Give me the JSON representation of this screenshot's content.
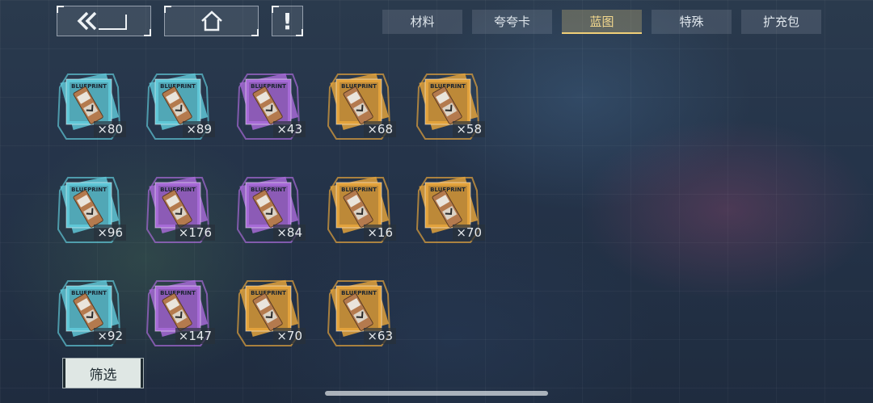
{
  "nav": {
    "back_icon": "double-chevron-back-icon",
    "home_icon": "home-icon",
    "info_label": "!"
  },
  "tabs": [
    {
      "label": "材料",
      "active": false
    },
    {
      "label": "夸夸卡",
      "active": false
    },
    {
      "label": "蓝图",
      "active": true
    },
    {
      "label": "特殊",
      "active": false
    },
    {
      "label": "扩充包",
      "active": false
    }
  ],
  "rarity_colors": {
    "blue": "#5fc6d6",
    "purple": "#a66ad6",
    "gold": "#e2a23c"
  },
  "card_label": "BLUEPRINT",
  "items": [
    {
      "rarity": "blue",
      "count": "×80"
    },
    {
      "rarity": "blue",
      "count": "×89"
    },
    {
      "rarity": "purple",
      "count": "×43"
    },
    {
      "rarity": "gold",
      "count": "×68"
    },
    {
      "rarity": "gold",
      "count": "×58"
    },
    {
      "rarity": "blue",
      "count": "×96"
    },
    {
      "rarity": "purple",
      "count": "×176"
    },
    {
      "rarity": "purple",
      "count": "×84"
    },
    {
      "rarity": "gold",
      "count": "×16"
    },
    {
      "rarity": "gold",
      "count": "×70"
    },
    {
      "rarity": "blue",
      "count": "×92"
    },
    {
      "rarity": "purple",
      "count": "×147"
    },
    {
      "rarity": "gold",
      "count": "×70"
    },
    {
      "rarity": "gold",
      "count": "×63"
    }
  ],
  "filter_label": "筛选"
}
